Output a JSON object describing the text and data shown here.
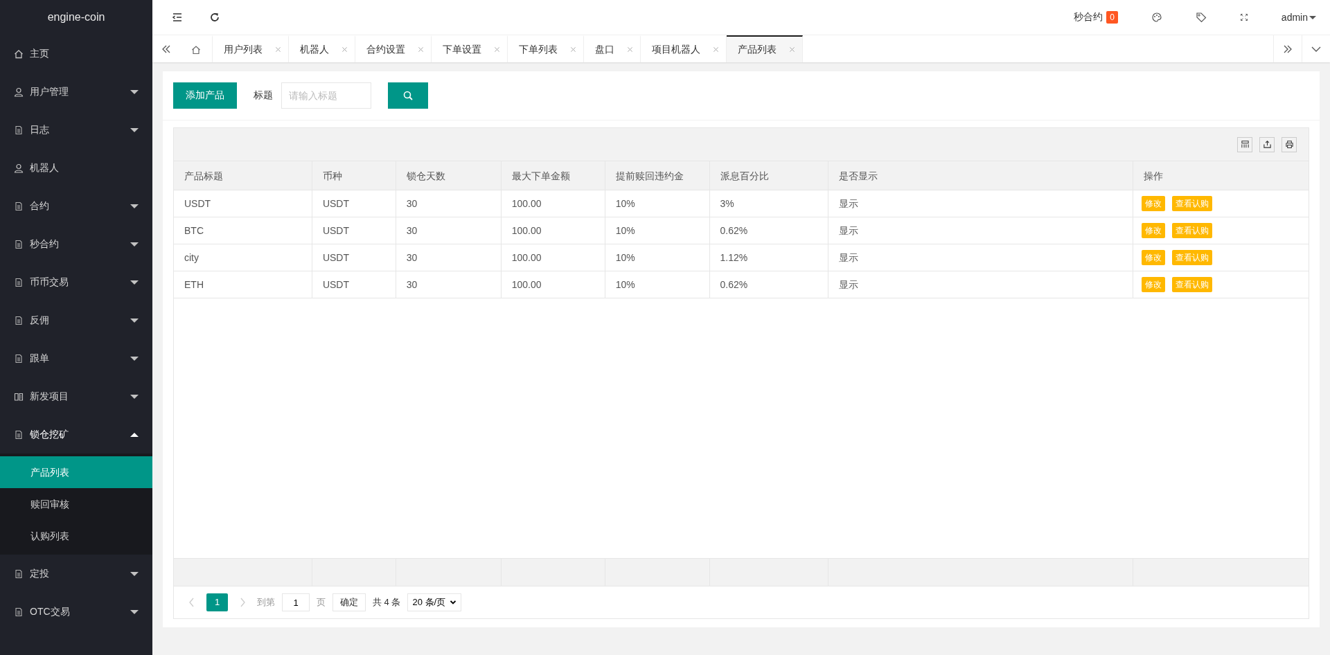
{
  "sidebar": {
    "logo": "engine-coin",
    "items": [
      {
        "label": "主页",
        "kind": "link"
      },
      {
        "label": "用户管理",
        "kind": "menu",
        "expanded": false
      },
      {
        "label": "日志",
        "kind": "menu",
        "expanded": false
      },
      {
        "label": "机器人",
        "kind": "link"
      },
      {
        "label": "合约",
        "kind": "menu",
        "expanded": false
      },
      {
        "label": "秒合约",
        "kind": "menu",
        "expanded": false
      },
      {
        "label": "币币交易",
        "kind": "menu",
        "expanded": false
      },
      {
        "label": "反佣",
        "kind": "menu",
        "expanded": false
      },
      {
        "label": "跟单",
        "kind": "menu",
        "expanded": false
      },
      {
        "label": "新发项目",
        "kind": "menu",
        "expanded": false
      },
      {
        "label": "锁仓挖矿",
        "kind": "menu",
        "expanded": true,
        "children": [
          {
            "label": "产品列表",
            "selected": true
          },
          {
            "label": "赎回审核",
            "selected": false
          },
          {
            "label": "认购列表",
            "selected": false
          }
        ]
      },
      {
        "label": "定投",
        "kind": "menu",
        "expanded": false
      },
      {
        "label": "OTC交易",
        "kind": "menu",
        "expanded": false
      }
    ]
  },
  "header": {
    "notice_label": "秒合约",
    "notice_count": "0",
    "user": "admin"
  },
  "tabs": [
    {
      "label": "用户列表",
      "selected": false
    },
    {
      "label": "机器人",
      "selected": false
    },
    {
      "label": "合约设置",
      "selected": false
    },
    {
      "label": "下单设置",
      "selected": false
    },
    {
      "label": "下单列表",
      "selected": false
    },
    {
      "label": "盘口",
      "selected": false
    },
    {
      "label": "项目机器人",
      "selected": false
    },
    {
      "label": "产品列表",
      "selected": true
    }
  ],
  "toolbar": {
    "add_button": "添加产品",
    "filter_label": "标题",
    "filter_placeholder": "请输入标题"
  },
  "table": {
    "columns": [
      "产品标题",
      "币种",
      "锁仓天数",
      "最大下单金额",
      "提前赎回违约金",
      "派息百分比",
      "是否显示",
      "操作"
    ],
    "rows": [
      {
        "cells": [
          "USDT",
          "USDT",
          "30",
          "100.00",
          "10%",
          "3%",
          "显示"
        ],
        "actions": [
          "修改",
          "查看认购"
        ]
      },
      {
        "cells": [
          "BTC",
          "USDT",
          "30",
          "100.00",
          "10%",
          "0.62%",
          "显示"
        ],
        "actions": [
          "修改",
          "查看认购"
        ]
      },
      {
        "cells": [
          "city",
          "USDT",
          "30",
          "100.00",
          "10%",
          "1.12%",
          "显示"
        ],
        "actions": [
          "修改",
          "查看认购"
        ]
      },
      {
        "cells": [
          "ETH",
          "USDT",
          "30",
          "100.00",
          "10%",
          "0.62%",
          "显示"
        ],
        "actions": [
          "修改",
          "查看认购"
        ]
      }
    ]
  },
  "pagination": {
    "pages": [
      {
        "label": "1",
        "selected": true
      }
    ],
    "goto_label": "到第",
    "goto_value": "1",
    "page_unit": "页",
    "confirm": "确定",
    "total": "共 4 条",
    "page_size": "20 条/页"
  }
}
